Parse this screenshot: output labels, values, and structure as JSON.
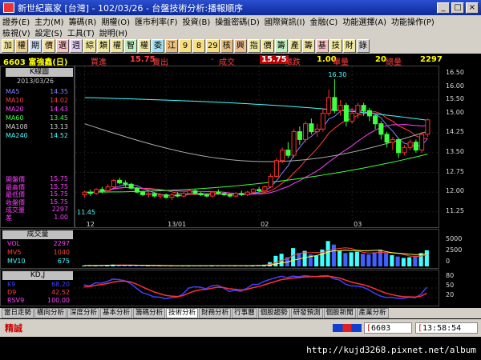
{
  "window": {
    "title": "新世紀贏家 [台灣] - 102/03/26 - 台盤技術分析:播報順序",
    "minimize": "_",
    "maximize": "□",
    "close": "×"
  },
  "menu": {
    "row1": [
      "證券(E)",
      "主力(M)",
      "籌碼(R)",
      "期權(O)",
      "匯市利率(F)",
      "投資(B)",
      "操盤密碼(D)",
      "國際資訊(I)",
      "金融(C)",
      "功能選擇(A)",
      "功能操作(P)"
    ],
    "row2": [
      "檢視(V)",
      "設定(S)",
      "工具(T)",
      "說明(H)"
    ]
  },
  "toolbar": {
    "items": [
      "加",
      "權",
      "期",
      "價",
      "選",
      "週",
      "綜",
      "類",
      "權",
      "智",
      "權",
      "委",
      "江",
      "9",
      "8",
      "29",
      "核",
      "興",
      "指",
      "價",
      "籌",
      "產",
      "籌",
      "基",
      "技",
      "財",
      "錄"
    ]
  },
  "info": {
    "code_name": "6603 富強鑫(日)",
    "buy_label": "買進",
    "buy_value": "15.75",
    "sell_label": "賣出",
    "sell_value": "-",
    "trade_label": "成交",
    "trade_value": "15.75",
    "change_label": "漲跌",
    "change_value": "1.00",
    "unit_label": "單量",
    "unit_value": "20",
    "total_label": "總量",
    "total_value": "2297"
  },
  "left": {
    "kline_title": "K線圖",
    "date": "2013/03/26",
    "ma": [
      {
        "name": "MA5",
        "value": "14.35",
        "color": "#8080ff"
      },
      {
        "name": "MA10",
        "value": "14.02",
        "color": "#ff4040"
      },
      {
        "name": "MA20",
        "value": "14.43",
        "color": "#ff40ff"
      },
      {
        "name": "MA60",
        "value": "13.45",
        "color": "#40ff40"
      },
      {
        "name": "MA108",
        "value": "13.13",
        "color": "#cccccc"
      },
      {
        "name": "MA240",
        "value": "14.52",
        "color": "#40ffff"
      }
    ],
    "prices": [
      {
        "name": "開盤價",
        "value": "15.75"
      },
      {
        "name": "最高價",
        "value": "15.75"
      },
      {
        "name": "最低價",
        "value": "15.75"
      },
      {
        "name": "收盤價",
        "value": "15.75"
      },
      {
        "name": "成交量",
        "value": "2297"
      },
      {
        "name": "差",
        "value": "1.00"
      }
    ]
  },
  "volume": {
    "title": "成交量",
    "rows": [
      {
        "name": "VOL",
        "value": "2297",
        "color": "#ff40ff"
      },
      {
        "name": "MV5",
        "value": "1040",
        "color": "#ff4040"
      },
      {
        "name": "MV10",
        "value": "675",
        "color": "#40ffff"
      }
    ],
    "axis": [
      "5000",
      "2500",
      "0"
    ]
  },
  "kd": {
    "title": "KD,J",
    "rows": [
      {
        "name": "K9",
        "value": "68.20",
        "color": "#4040ff"
      },
      {
        "name": "D9",
        "value": "42.52",
        "color": "#ff4040"
      },
      {
        "name": "RSV9",
        "value": "100.00",
        "color": "#ff40ff"
      }
    ],
    "axis": [
      "80",
      "50",
      "20"
    ]
  },
  "chart": {
    "yticks": [
      "16.50",
      "16.00",
      "15.50",
      "15.00",
      "14.25",
      "13.50",
      "12.75",
      "12.00",
      "11.25"
    ],
    "xlabels": [
      "12",
      "13/01",
      "02",
      "03"
    ],
    "high_label": "16.30",
    "low_label": "11.45"
  },
  "chart_data": {
    "type": "candlestick",
    "ylim": [
      11.0,
      16.6
    ],
    "x_labels": [
      "12",
      "13/01",
      "02",
      "03"
    ],
    "candles": [
      [
        11.9,
        12.0,
        11.8,
        12.05
      ],
      [
        12.0,
        11.95,
        11.85,
        12.1
      ],
      [
        11.95,
        12.1,
        11.9,
        12.15
      ],
      [
        12.1,
        12.05,
        11.95,
        12.2
      ],
      [
        12.05,
        12.2,
        12.0,
        12.3
      ],
      [
        12.2,
        12.45,
        12.15,
        12.5
      ],
      [
        12.45,
        12.35,
        12.3,
        12.55
      ],
      [
        12.35,
        12.3,
        12.2,
        12.45
      ],
      [
        12.3,
        12.15,
        12.1,
        12.35
      ],
      [
        12.15,
        12.0,
        11.95,
        12.2
      ],
      [
        12.0,
        11.9,
        11.85,
        12.05
      ],
      [
        11.9,
        11.95,
        11.8,
        12.0
      ],
      [
        11.95,
        11.85,
        11.8,
        12.0
      ],
      [
        11.85,
        11.9,
        11.75,
        11.95
      ],
      [
        11.9,
        11.8,
        11.75,
        11.95
      ],
      [
        11.8,
        11.9,
        11.7,
        11.95
      ],
      [
        11.9,
        11.85,
        11.8,
        12.0
      ],
      [
        11.85,
        11.95,
        11.8,
        12.0
      ],
      [
        11.95,
        12.05,
        11.9,
        12.1
      ],
      [
        12.05,
        11.95,
        11.9,
        12.1
      ],
      [
        11.95,
        11.9,
        11.85,
        12.0
      ],
      [
        11.9,
        11.85,
        11.8,
        11.95
      ],
      [
        11.85,
        12.0,
        11.8,
        12.05
      ],
      [
        12.0,
        11.95,
        11.9,
        12.1
      ],
      [
        11.95,
        11.9,
        11.85,
        12.0
      ],
      [
        11.9,
        11.85,
        11.8,
        11.95
      ],
      [
        11.85,
        11.95,
        11.8,
        12.0
      ],
      [
        11.95,
        11.9,
        11.85,
        12.05
      ],
      [
        11.9,
        12.0,
        11.85,
        12.05
      ],
      [
        12.0,
        12.1,
        11.95,
        12.15
      ],
      [
        12.1,
        12.05,
        12.0,
        12.2
      ],
      [
        12.05,
        12.2,
        12.0,
        12.25
      ],
      [
        12.2,
        12.6,
        12.15,
        12.7
      ],
      [
        12.6,
        13.2,
        12.55,
        13.3
      ],
      [
        13.2,
        13.6,
        13.1,
        13.7
      ],
      [
        13.6,
        13.4,
        13.3,
        13.9
      ],
      [
        13.4,
        14.3,
        13.3,
        14.4
      ],
      [
        14.3,
        14.0,
        13.8,
        14.5
      ],
      [
        14.0,
        14.6,
        13.9,
        14.7
      ],
      [
        14.6,
        14.3,
        14.2,
        14.8
      ],
      [
        14.3,
        14.4,
        14.1,
        14.6
      ],
      [
        14.4,
        15.0,
        14.3,
        15.2
      ],
      [
        15.0,
        15.6,
        14.9,
        15.9
      ],
      [
        15.6,
        15.1,
        15.0,
        16.3
      ],
      [
        15.1,
        15.3,
        14.9,
        15.5
      ],
      [
        15.3,
        14.7,
        14.5,
        15.4
      ],
      [
        14.7,
        15.0,
        14.6,
        15.2
      ],
      [
        15.0,
        15.3,
        14.8,
        15.4
      ],
      [
        15.3,
        15.1,
        14.9,
        15.4
      ],
      [
        15.1,
        14.9,
        14.7,
        15.2
      ],
      [
        14.9,
        14.6,
        14.4,
        15.0
      ],
      [
        14.6,
        14.2,
        14.0,
        14.7
      ],
      [
        14.2,
        13.9,
        13.7,
        14.3
      ],
      [
        13.9,
        14.0,
        13.6,
        14.1
      ],
      [
        14.0,
        13.5,
        13.3,
        14.05
      ],
      [
        13.5,
        13.7,
        13.4,
        13.8
      ],
      [
        13.7,
        13.9,
        13.6,
        14.0
      ],
      [
        13.9,
        13.6,
        13.5,
        14.0
      ],
      [
        13.6,
        14.2,
        13.5,
        14.3
      ],
      [
        14.2,
        14.75,
        14.1,
        14.8
      ]
    ],
    "series": [
      {
        "name": "MA5",
        "color": "#8080ff"
      },
      {
        "name": "MA10",
        "color": "#ff4040"
      },
      {
        "name": "MA20",
        "color": "#ff40ff"
      },
      {
        "name": "MA60",
        "color": "#40ff40"
      },
      {
        "name": "MA108",
        "color": "#cccccc"
      },
      {
        "name": "MA240",
        "color": "#40ffff"
      }
    ],
    "volumes": [
      120,
      150,
      110,
      180,
      220,
      260,
      200,
      160,
      140,
      130,
      90,
      80,
      70,
      100,
      90,
      85,
      120,
      110,
      150,
      130,
      100,
      90,
      120,
      110,
      95,
      80,
      100,
      110,
      130,
      180,
      200,
      240,
      600,
      1500,
      1800,
      1300,
      2600,
      1900,
      2200,
      1700,
      1500,
      2400,
      3600,
      3100,
      2200,
      1900,
      2000,
      2100,
      1800,
      1700,
      2000,
      2400,
      1900,
      1600,
      1400,
      1200,
      1300,
      1500,
      1900,
      2297
    ],
    "vol_ylim": [
      0,
      5000
    ],
    "kd_ylim": [
      0,
      100
    ]
  },
  "tabs": [
    "當日走勢",
    "橫向分析",
    "深度分析",
    "基本分析",
    "籌碼分析",
    "技術分析",
    "財務分析",
    "行事曆",
    "個股趨勢",
    "研發預測",
    "個股新聞",
    "產業分析"
  ],
  "active_tab": "技術分析",
  "status": {
    "stock_label": "精誠",
    "code": "6603",
    "time": "13:58:54"
  },
  "footer": {
    "url": "http://kujd3268.pixnet.net/album"
  }
}
